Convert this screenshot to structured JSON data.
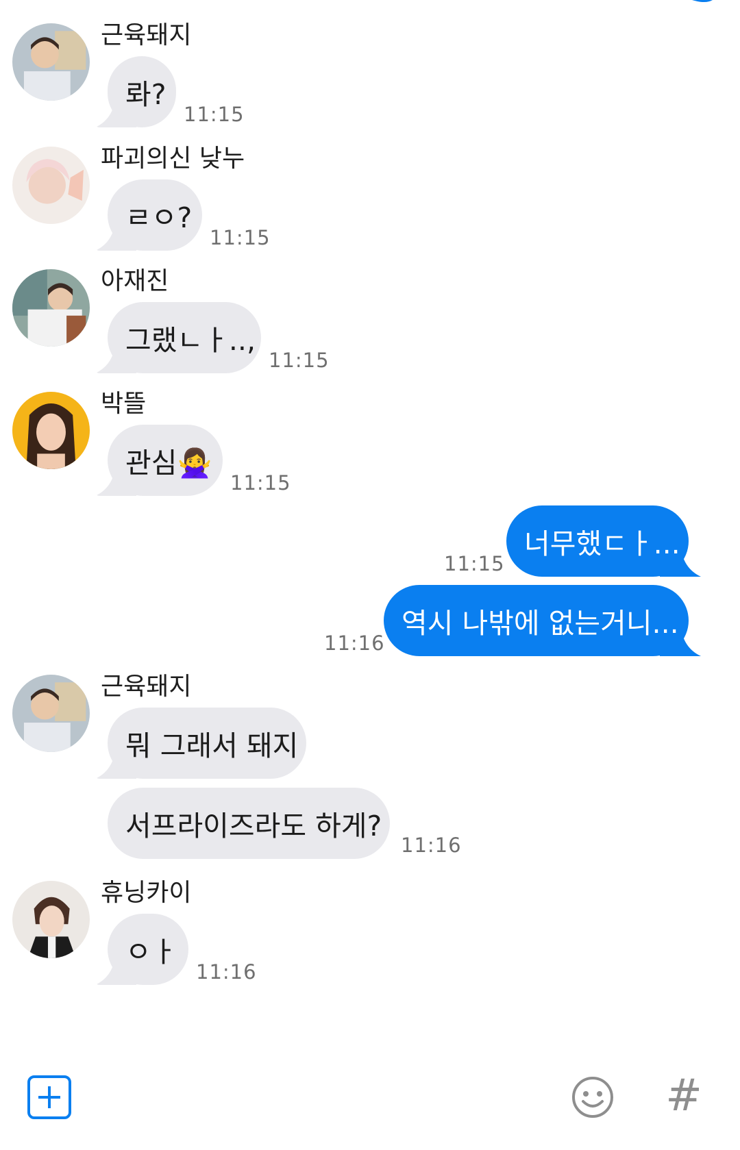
{
  "messages": [
    {
      "sender": "근육돼지",
      "text": "롸?",
      "time": "11:15"
    },
    {
      "sender": "파괴의신 낮누",
      "text": "ㄹㅇ?",
      "time": "11:15"
    },
    {
      "sender": "아재진",
      "text": "그랬ㄴㅏ..,",
      "time": "11:15"
    },
    {
      "sender": "박뜰",
      "text": "관심🙅‍♀️",
      "time": "11:15"
    },
    {
      "text": "너무했ㄷㅏ...",
      "time": "11:15"
    },
    {
      "text": "역시 나밖에 없는거니...",
      "time": "11:16"
    },
    {
      "sender": "근육돼지",
      "text": "뭐 그래서 돼지",
      "time": ""
    },
    {
      "text": "서프라이즈라도 하게?",
      "time": "11:16"
    },
    {
      "sender": "휴닝카이",
      "text": "ㅇㅏ",
      "time": "11:16"
    }
  ],
  "input_bar": {
    "add_icon": "plus-square-icon",
    "emoji_icon": "smiley-face-icon",
    "hash_label": "#"
  },
  "colors": {
    "incoming_bubble": "#e9e9ed",
    "outgoing_bubble": "#0a7ff0",
    "accent": "#0a7ff0"
  }
}
